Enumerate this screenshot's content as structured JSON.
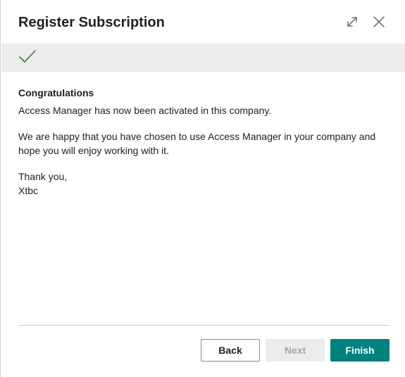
{
  "dialog": {
    "title": "Register Subscription",
    "icons": {
      "expand": "expand-icon",
      "close": "close-icon"
    }
  },
  "status": {
    "icon": "checkmark-icon",
    "color": "#2e7d32"
  },
  "content": {
    "heading": "Congratulations",
    "activated": "Access Manager has now been activated in this company.",
    "message_line1": "We are happy that you have chosen to use Access Manager in your company and",
    "message_line2": "hope you will enjoy working with it.",
    "thanks": "Thank you,",
    "signature": "Xtbc"
  },
  "buttons": {
    "back": "Back",
    "next": "Next",
    "finish": "Finish"
  },
  "colors": {
    "accent": "#00807f",
    "band": "#ececec"
  }
}
